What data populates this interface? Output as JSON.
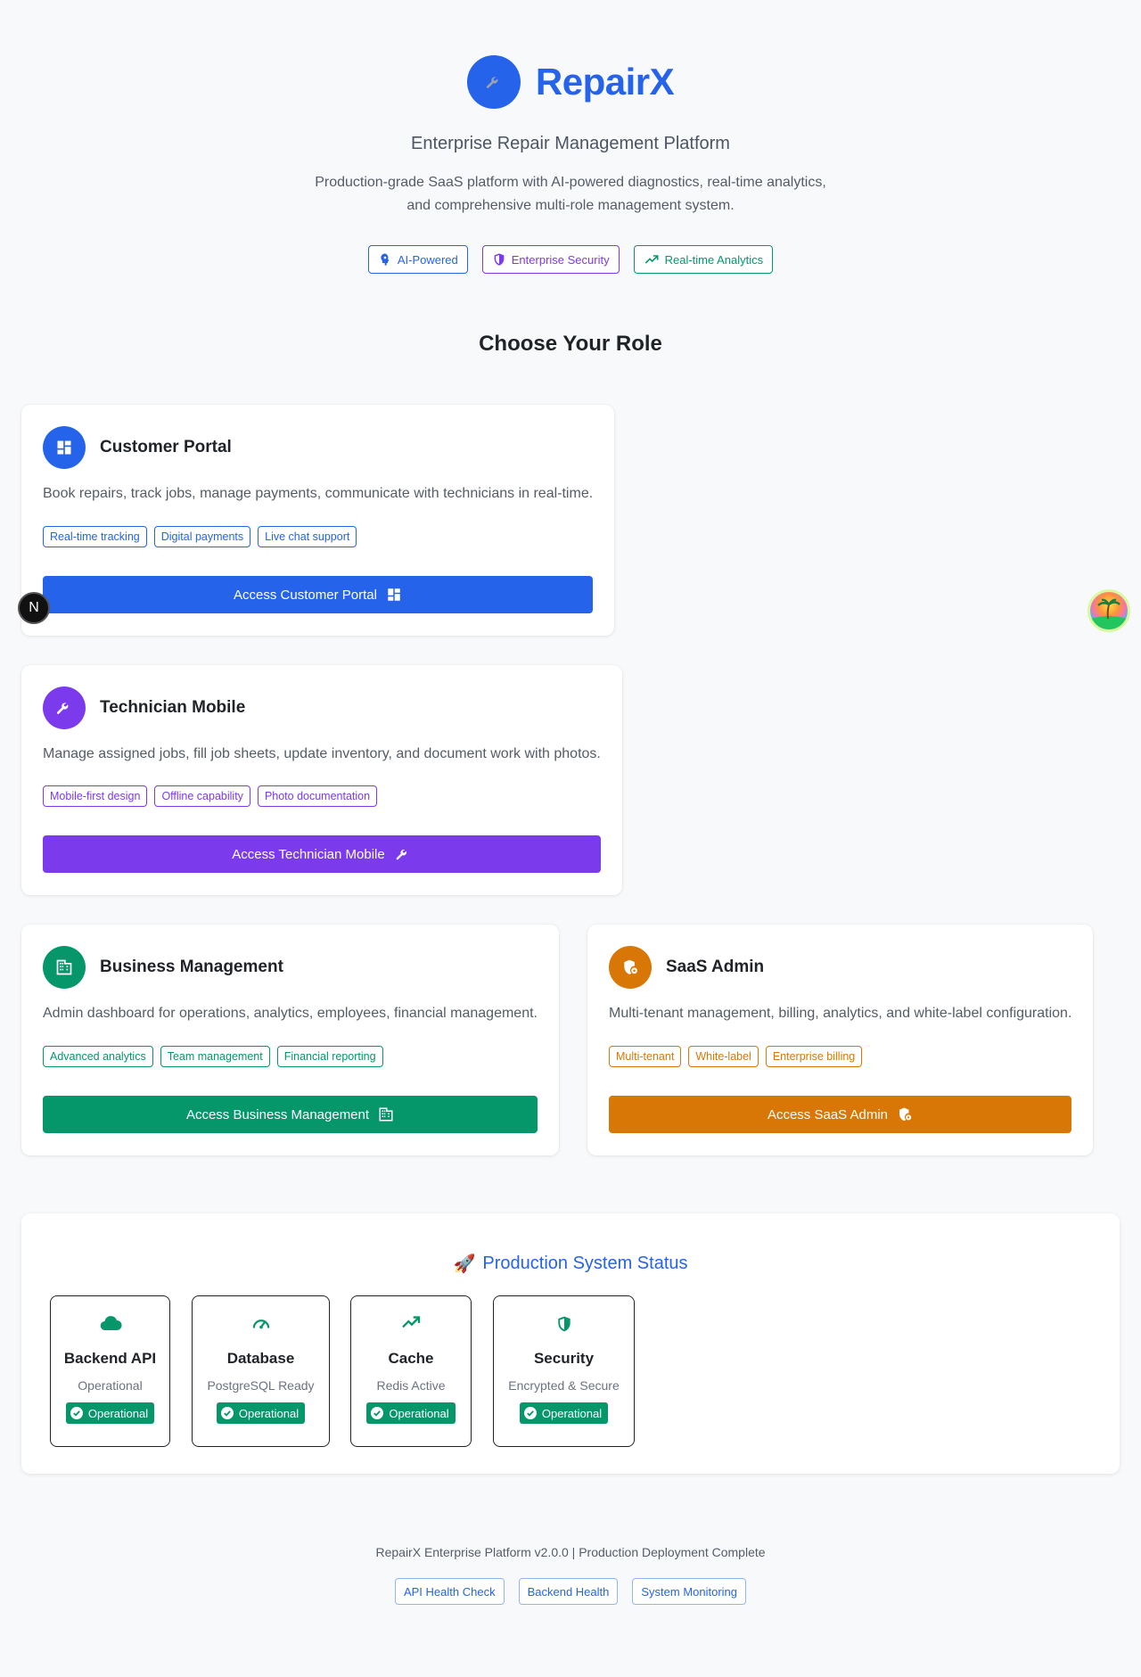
{
  "brand": {
    "name": "RepairX",
    "tagline": "Enterprise Repair Management Platform",
    "description": "Production-grade SaaS platform with AI-powered diagnostics, real-time analytics, and comprehensive multi-role management system.",
    "accent": "#2563eb"
  },
  "hero_badges": [
    {
      "label": "AI-Powered",
      "icon": "brain-icon",
      "color": "#2563eb"
    },
    {
      "label": "Enterprise Security",
      "icon": "shield-icon",
      "color": "#7c3aed"
    },
    {
      "label": "Real-time Analytics",
      "icon": "trending-up-icon",
      "color": "#059669"
    }
  ],
  "section_title": "Choose Your Role",
  "roles": [
    {
      "title": "Customer Portal",
      "description": "Book repairs, track jobs, manage payments, communicate with technicians in real-time.",
      "features": [
        "Real-time tracking",
        "Digital payments",
        "Live chat support"
      ],
      "button": "Access Customer Portal",
      "icon": "dashboard-icon",
      "color": "#2563eb"
    },
    {
      "title": "Technician Mobile",
      "description": "Manage assigned jobs, fill job sheets, update inventory, and document work with photos.",
      "features": [
        "Mobile-first design",
        "Offline capability",
        "Photo documentation"
      ],
      "button": "Access Technician Mobile",
      "icon": "wrench-icon",
      "color": "#7c3aed"
    },
    {
      "title": "Business Management",
      "description": "Admin dashboard for operations, analytics, employees, financial management.",
      "features": [
        "Advanced analytics",
        "Team management",
        "Financial reporting"
      ],
      "button": "Access Business Management",
      "icon": "building-icon",
      "color": "#059669"
    },
    {
      "title": "SaaS Admin",
      "description": "Multi-tenant management, billing, analytics, and white-label configuration.",
      "features": [
        "Multi-tenant",
        "White-label",
        "Enterprise billing"
      ],
      "button": "Access SaaS Admin",
      "icon": "admin-shield-icon",
      "color": "#d97706"
    }
  ],
  "status": {
    "title": "Production System Status",
    "title_emoji": "🚀",
    "items": [
      {
        "name": "Backend API",
        "detail": "Operational",
        "badge": "Operational",
        "icon": "cloud-icon"
      },
      {
        "name": "Database",
        "detail": "PostgreSQL Ready",
        "badge": "Operational",
        "icon": "speedometer-icon"
      },
      {
        "name": "Cache",
        "detail": "Redis Active",
        "badge": "Operational",
        "icon": "trending-up-icon"
      },
      {
        "name": "Security",
        "detail": "Encrypted & Secure",
        "badge": "Operational",
        "icon": "shield-icon"
      }
    ],
    "badge_color": "#059669"
  },
  "footer": {
    "text": "RepairX Enterprise Platform v2.0.0 | Production Deployment Complete",
    "links": [
      "API Health Check",
      "Backend Health",
      "System Monitoring"
    ]
  },
  "floating": {
    "dev_badge": "N"
  }
}
